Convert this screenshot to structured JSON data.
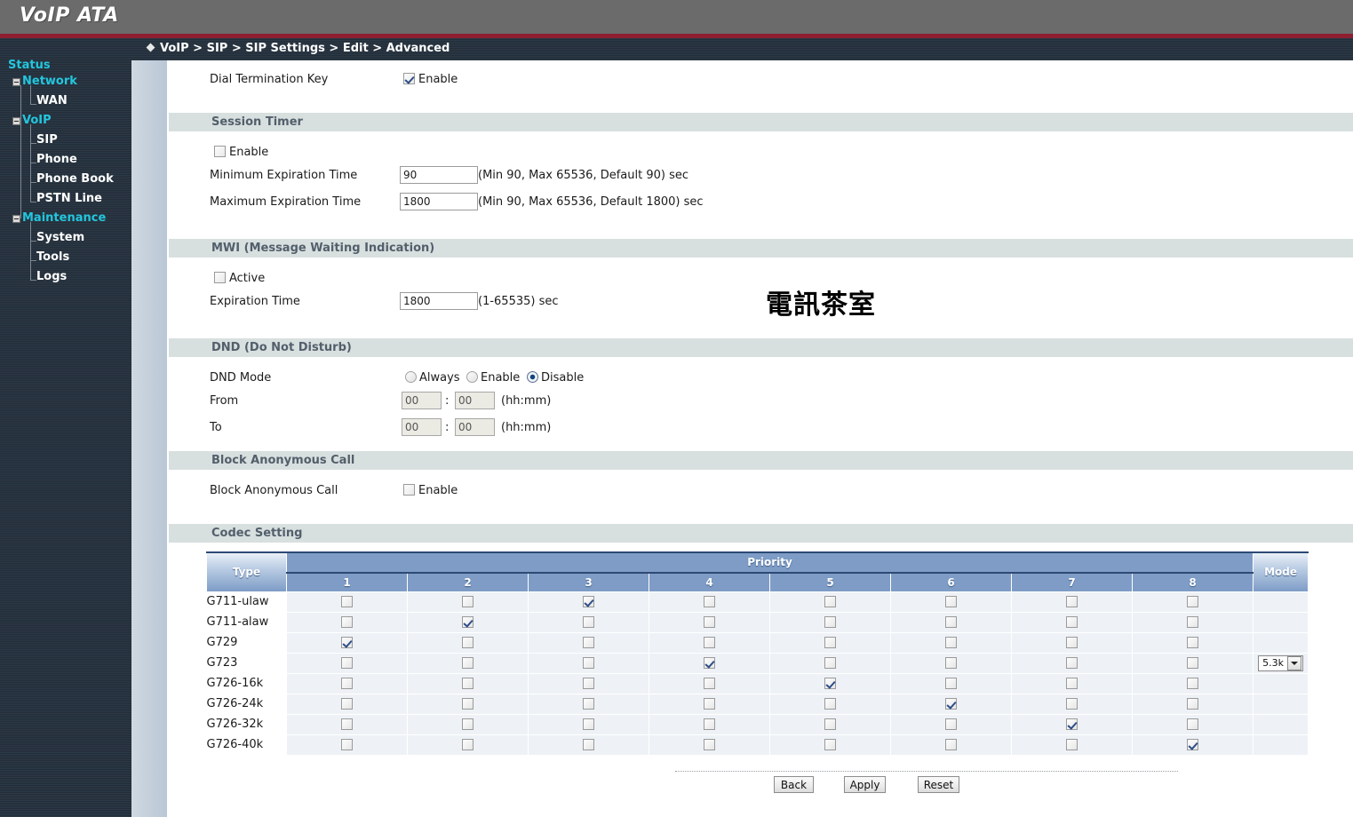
{
  "header": {
    "brand": "VoIP ATA"
  },
  "breadcrumb": {
    "text": "VoIP > SIP > SIP Settings > Edit > Advanced"
  },
  "sidebar": {
    "items": [
      {
        "label": "Status",
        "level": "top",
        "expandable": false
      },
      {
        "label": "Network",
        "level": "top",
        "expandable": true
      },
      {
        "label": "WAN",
        "level": "sub"
      },
      {
        "label": "VoIP",
        "level": "top",
        "expandable": true
      },
      {
        "label": "SIP",
        "level": "sub"
      },
      {
        "label": "Phone",
        "level": "sub"
      },
      {
        "label": "Phone Book",
        "level": "sub"
      },
      {
        "label": "PSTN Line",
        "level": "sub"
      },
      {
        "label": "Maintenance",
        "level": "top",
        "expandable": true
      },
      {
        "label": "System",
        "level": "sub"
      },
      {
        "label": "Tools",
        "level": "sub"
      },
      {
        "label": "Logs",
        "level": "sub"
      }
    ]
  },
  "watermark": "電訊茶室",
  "dial_termination": {
    "label": "Dial Termination Key",
    "enable_label": "Enable",
    "enabled": true
  },
  "session_timer": {
    "section_title": "Session Timer",
    "enable_label": "Enable",
    "enabled": false,
    "min_label": "Minimum Expiration Time",
    "min_value": "90",
    "min_hint": "(Min 90, Max 65536, Default 90) sec",
    "max_label": "Maximum Expiration Time",
    "max_value": "1800",
    "max_hint": "(Min 90, Max 65536, Default 1800) sec"
  },
  "mwi": {
    "section_title": "MWI (Message Waiting Indication)",
    "active_label": "Active",
    "active": false,
    "expiration_label": "Expiration Time",
    "expiration_value": "1800",
    "expiration_hint": "(1-65535) sec"
  },
  "dnd": {
    "section_title": "DND (Do Not Disturb)",
    "mode_label": "DND Mode",
    "options": [
      "Always",
      "Enable",
      "Disable"
    ],
    "selected": "Disable",
    "from_label": "From",
    "from_hh": "00",
    "from_mm": "00",
    "from_hint": "(hh:mm)",
    "to_label": "To",
    "to_hh": "00",
    "to_mm": "00",
    "to_hint": "(hh:mm)",
    "separator": ":"
  },
  "block_anonymous": {
    "section_title": "Block Anonymous Call",
    "label": "Block Anonymous Call",
    "enable_label": "Enable",
    "enabled": false
  },
  "codec": {
    "section_title": "Codec Setting",
    "type_header": "Type",
    "priority_header": "Priority",
    "mode_header": "Mode",
    "priority_columns": [
      "1",
      "2",
      "3",
      "4",
      "5",
      "6",
      "7",
      "8"
    ],
    "rows": [
      {
        "type": "G711-ulaw",
        "priority": 3,
        "mode": null
      },
      {
        "type": "G711-alaw",
        "priority": 2,
        "mode": null
      },
      {
        "type": "G729",
        "priority": 1,
        "mode": null
      },
      {
        "type": "G723",
        "priority": 4,
        "mode": "5.3k"
      },
      {
        "type": "G726-16k",
        "priority": 5,
        "mode": null
      },
      {
        "type": "G726-24k",
        "priority": 6,
        "mode": null
      },
      {
        "type": "G726-32k",
        "priority": 7,
        "mode": null
      },
      {
        "type": "G726-40k",
        "priority": 8,
        "mode": null
      }
    ]
  },
  "footer": {
    "back": "Back",
    "apply": "Apply",
    "reset": "Reset"
  },
  "colors": {
    "banner": "#6b6b6b",
    "accent_red": "#8e1f31",
    "sidebar_top_link": "#23c6de",
    "section_header_bg": "#d8dfdf",
    "table_header_blue": "#7e9cc6"
  }
}
